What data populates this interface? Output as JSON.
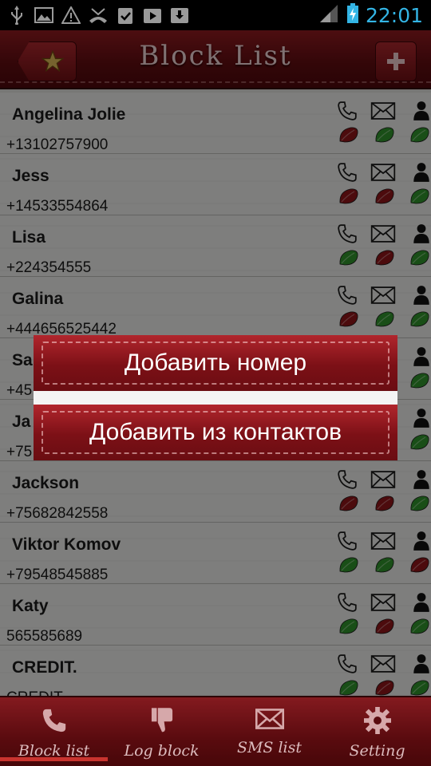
{
  "status_bar": {
    "time": "22:01",
    "icons": [
      "usb-icon",
      "image-icon",
      "warning-icon",
      "missed-call-icon",
      "clipboard-check-icon",
      "play-store-icon",
      "download-icon"
    ]
  },
  "header": {
    "title": "Block List",
    "left_icon": "star-icon",
    "right_icon": "plus-icon"
  },
  "contacts": [
    {
      "name": "Angelina Jolie",
      "number": "+13102757900",
      "call": "red",
      "sms": "green",
      "contact": "green"
    },
    {
      "name": "Jess",
      "number": "+14533554864",
      "call": "red",
      "sms": "red",
      "contact": "green"
    },
    {
      "name": "Lisa",
      "number": "+224354555",
      "call": "green",
      "sms": "red",
      "contact": "green"
    },
    {
      "name": "Galina",
      "number": "+444656525442",
      "call": "red",
      "sms": "green",
      "contact": "green"
    },
    {
      "name": "Sa",
      "number": "+45",
      "call": "red",
      "sms": "red",
      "contact": "green"
    },
    {
      "name": "Ja",
      "number": "+75",
      "call": "red",
      "sms": "red",
      "contact": "green"
    },
    {
      "name": "Jackson",
      "number": "+75682842558",
      "call": "red",
      "sms": "red",
      "contact": "green"
    },
    {
      "name": "Viktor Komov",
      "number": "+79548545885",
      "call": "green",
      "sms": "green",
      "contact": "red"
    },
    {
      "name": "Katy",
      "number": "565585689",
      "call": "green",
      "sms": "red",
      "contact": "green"
    },
    {
      "name": "CREDIT.",
      "number": "CREDIT",
      "call": "green",
      "sms": "red",
      "contact": "green"
    }
  ],
  "dialog": {
    "add_number": "Добавить номер",
    "add_from_contacts": "Добавить из контактов"
  },
  "tabs": [
    {
      "label": "Block list",
      "icon": "phone-icon",
      "active": true
    },
    {
      "label": "Log block",
      "icon": "thumbs-down-icon",
      "active": false
    },
    {
      "label": "SMS list",
      "icon": "envelope-icon",
      "active": false
    },
    {
      "label": "Setting",
      "icon": "gear-icon",
      "active": false
    }
  ],
  "colors": {
    "accent_red": "#7c1016",
    "leaf_green": "#2f8f2a",
    "leaf_red": "#8a1418",
    "clock_blue": "#33b5e5"
  }
}
